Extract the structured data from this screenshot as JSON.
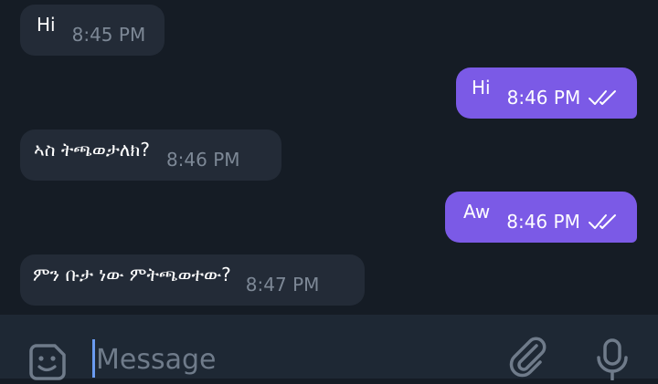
{
  "messages": [
    {
      "direction": "incoming",
      "text": "Hi",
      "time": "8:45 PM"
    },
    {
      "direction": "outgoing",
      "text": "Hi",
      "time": "8:46 PM",
      "status": "read"
    },
    {
      "direction": "incoming",
      "text": "ኣስ ትጫወታለክ?",
      "time": "8:46 PM"
    },
    {
      "direction": "outgoing",
      "text": "Aw",
      "time": "8:46 PM",
      "status": "read"
    },
    {
      "direction": "incoming",
      "text": "ምን ቡታ ነው ምትጫወተው?",
      "time": "8:47 PM"
    }
  ],
  "composer": {
    "placeholder": "Message",
    "icons": {
      "emoji": "sticker-smile-icon",
      "attach": "paperclip-icon",
      "voice": "microphone-icon"
    }
  },
  "colors": {
    "background": "#151c25",
    "incoming_bubble": "#232b37",
    "outgoing_bubble": "#7b5ae6",
    "composer_background": "#1e2834",
    "cursor": "#6a9bf0"
  }
}
